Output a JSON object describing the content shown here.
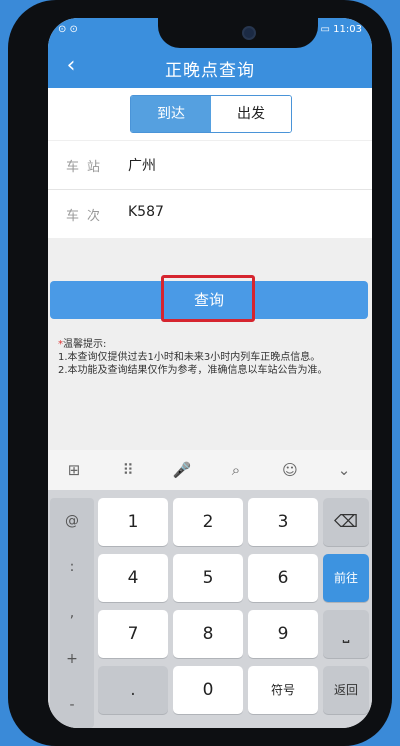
{
  "status_bar": {
    "left": "⊙ ⊙",
    "right": "63% ▭ 11:03"
  },
  "header": {
    "back_icon": "‹",
    "title": "正晚点查询"
  },
  "segment": {
    "arrive_label": "到达",
    "depart_label": "出发"
  },
  "station": {
    "label": "车站",
    "value": "广州"
  },
  "train": {
    "label": "车次",
    "value": "K587"
  },
  "query_button_label": "查询",
  "tips": {
    "title": "温馨提示:",
    "line1": "1.本查询仅提供过去1小时和未来3小时内列车正晚点信息。",
    "line2": "2.本功能及查询结果仅作为参考，准确信息以车站公告为准。"
  },
  "toolbar_icons": {
    "grid": "⊞",
    "dots": "⠿",
    "mic": "🎤",
    "search": "⌕",
    "emoji": "☺",
    "collapse": "⌄"
  },
  "keyboard": {
    "side_keys": [
      "@",
      ":",
      ",",
      "+",
      "-"
    ],
    "digits": [
      "1",
      "2",
      "3",
      "4",
      "5",
      "6",
      "7",
      "8",
      "9",
      "0"
    ],
    "dot": ".",
    "backspace": "⌫",
    "go_label": "前往",
    "space": "⎵",
    "symbol_label": "符号",
    "return_label": "返回"
  }
}
